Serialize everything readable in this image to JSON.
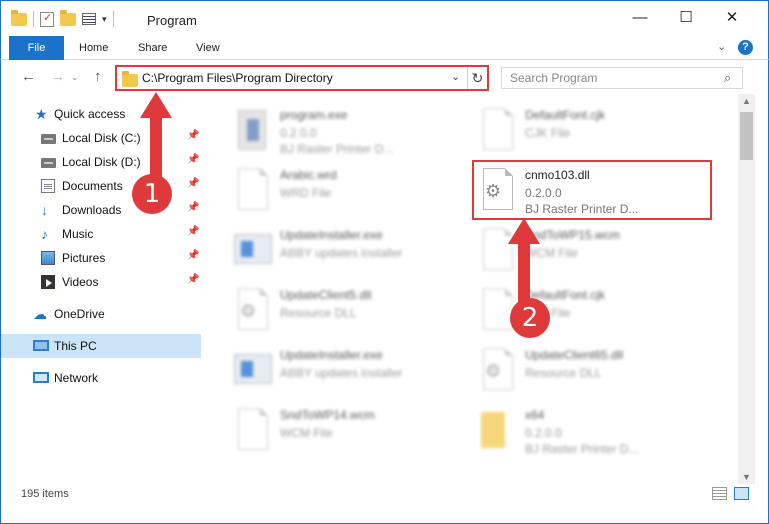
{
  "window": {
    "title": "Program",
    "controls": {
      "minimize": "—",
      "maximize": "☐",
      "close": "✕"
    }
  },
  "ribbon": {
    "tabs": [
      "File",
      "Home",
      "Share",
      "View"
    ],
    "chevron": "⌄",
    "help": "?"
  },
  "navigation": {
    "back": "←",
    "forward": "→",
    "history": "⌄",
    "up": "↑",
    "address": "C:\\Program Files\\Program Directory",
    "search_placeholder": "Search Program",
    "refresh": "↻",
    "search_icon": "⌕",
    "address_dropdown": "⌄"
  },
  "sidebar": {
    "items": [
      {
        "label": "Quick access",
        "icon": "star-icon",
        "pinned": false
      },
      {
        "label": "Local Disk (C:)",
        "icon": "disk-icon",
        "pinned": true
      },
      {
        "label": "Local Disk (D:)",
        "icon": "disk-icon",
        "pinned": true
      },
      {
        "label": "Documents",
        "icon": "documents-icon",
        "pinned": true
      },
      {
        "label": "Downloads",
        "icon": "downloads-icon",
        "pinned": true
      },
      {
        "label": "Music",
        "icon": "music-icon",
        "pinned": true
      },
      {
        "label": "Pictures",
        "icon": "pictures-icon",
        "pinned": true
      },
      {
        "label": "Videos",
        "icon": "videos-icon",
        "pinned": true
      },
      {
        "label": "OneDrive",
        "icon": "cloud-icon",
        "pinned": false
      },
      {
        "label": "This PC",
        "icon": "pc-icon",
        "pinned": false,
        "selected": true
      },
      {
        "label": "Network",
        "icon": "network-icon",
        "pinned": false
      }
    ],
    "pin_glyph": "📌"
  },
  "files": [
    {
      "name": "program.exe",
      "sub1": "0.2.0.0",
      "sub2": "BJ Raster Printer D...",
      "icon": "package"
    },
    {
      "name": "DefaultFont.cjk",
      "sub1": "CJK File",
      "sub2": "",
      "icon": "doc"
    },
    {
      "name": "Arabic.wrd",
      "sub1": "WRD File",
      "sub2": "",
      "icon": "doc"
    },
    {
      "name": "cnmo103.dll",
      "sub1": "0.2.0.0",
      "sub2": "BJ Raster Printer D...",
      "icon": "dll"
    },
    {
      "name": "UpdateInstaller.exe",
      "sub1": "ABBY updates installer",
      "sub2": "",
      "icon": "exe"
    },
    {
      "name": "SndToWP15.wcm",
      "sub1": "WCM File",
      "sub2": "",
      "icon": "doc"
    },
    {
      "name": "UpdateClient5.dll",
      "sub1": "Resource DLL",
      "sub2": "",
      "icon": "dll"
    },
    {
      "name": "DefaultFont.cjk",
      "sub1": "CJK File",
      "sub2": "",
      "icon": "doc"
    },
    {
      "name": "UpdateInstaller.exe",
      "sub1": "ABBY updates installer",
      "sub2": "",
      "icon": "exe"
    },
    {
      "name": "UpdateClient65.dll",
      "sub1": "Resource DLL",
      "sub2": "",
      "icon": "dll"
    },
    {
      "name": "SndToWP14.wcm",
      "sub1": "WCM File",
      "sub2": "",
      "icon": "doc"
    },
    {
      "name": "x64",
      "sub1": "0.2.0.0",
      "sub2": "BJ Raster Printer D...",
      "icon": "folder"
    }
  ],
  "status": {
    "count": "195 items"
  },
  "annotations": {
    "step1": "1",
    "step2": "2"
  },
  "colors": {
    "accent": "#1a73c8",
    "highlight": "#e0393c",
    "selected": "#cce4f7"
  }
}
